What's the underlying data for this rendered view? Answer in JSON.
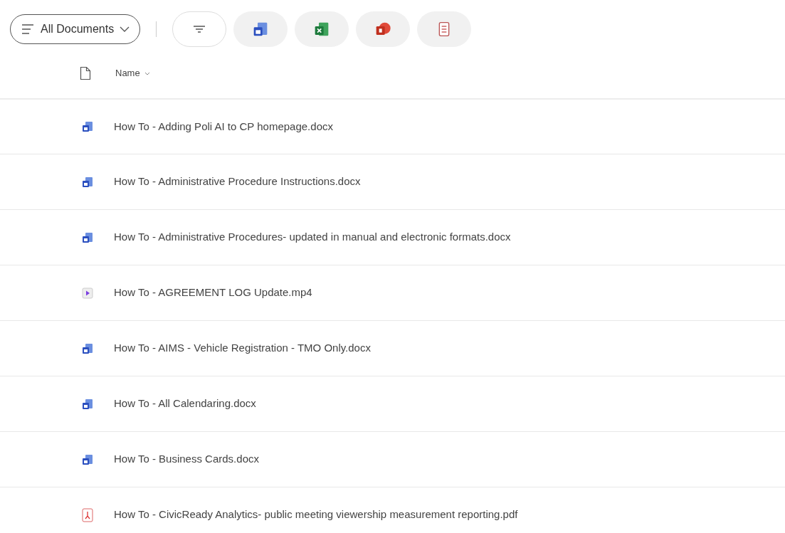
{
  "view_selector": {
    "label": "All Documents"
  },
  "filters": [
    {
      "kind": "filter"
    },
    {
      "kind": "word"
    },
    {
      "kind": "excel"
    },
    {
      "kind": "powerpoint"
    },
    {
      "kind": "form"
    }
  ],
  "table": {
    "columns": [
      {
        "label": "Name"
      }
    ],
    "rows": [
      {
        "kind": "word",
        "name": "How To - Adding Poli AI to CP homepage.docx"
      },
      {
        "kind": "word",
        "name": "How To - Administrative Procedure Instructions.docx"
      },
      {
        "kind": "word",
        "name": "How To - Administrative Procedures- updated in manual and electronic formats.docx"
      },
      {
        "kind": "video",
        "name": "How To - AGREEMENT LOG Update.mp4"
      },
      {
        "kind": "word",
        "name": "How To - AIMS - Vehicle Registration - TMO Only.docx"
      },
      {
        "kind": "word",
        "name": "How To - All Calendaring.docx"
      },
      {
        "kind": "word",
        "name": "How To - Business Cards.docx"
      },
      {
        "kind": "pdf",
        "name": "How To - CivicReady Analytics- public meeting viewership measurement reporting.pdf"
      }
    ]
  }
}
